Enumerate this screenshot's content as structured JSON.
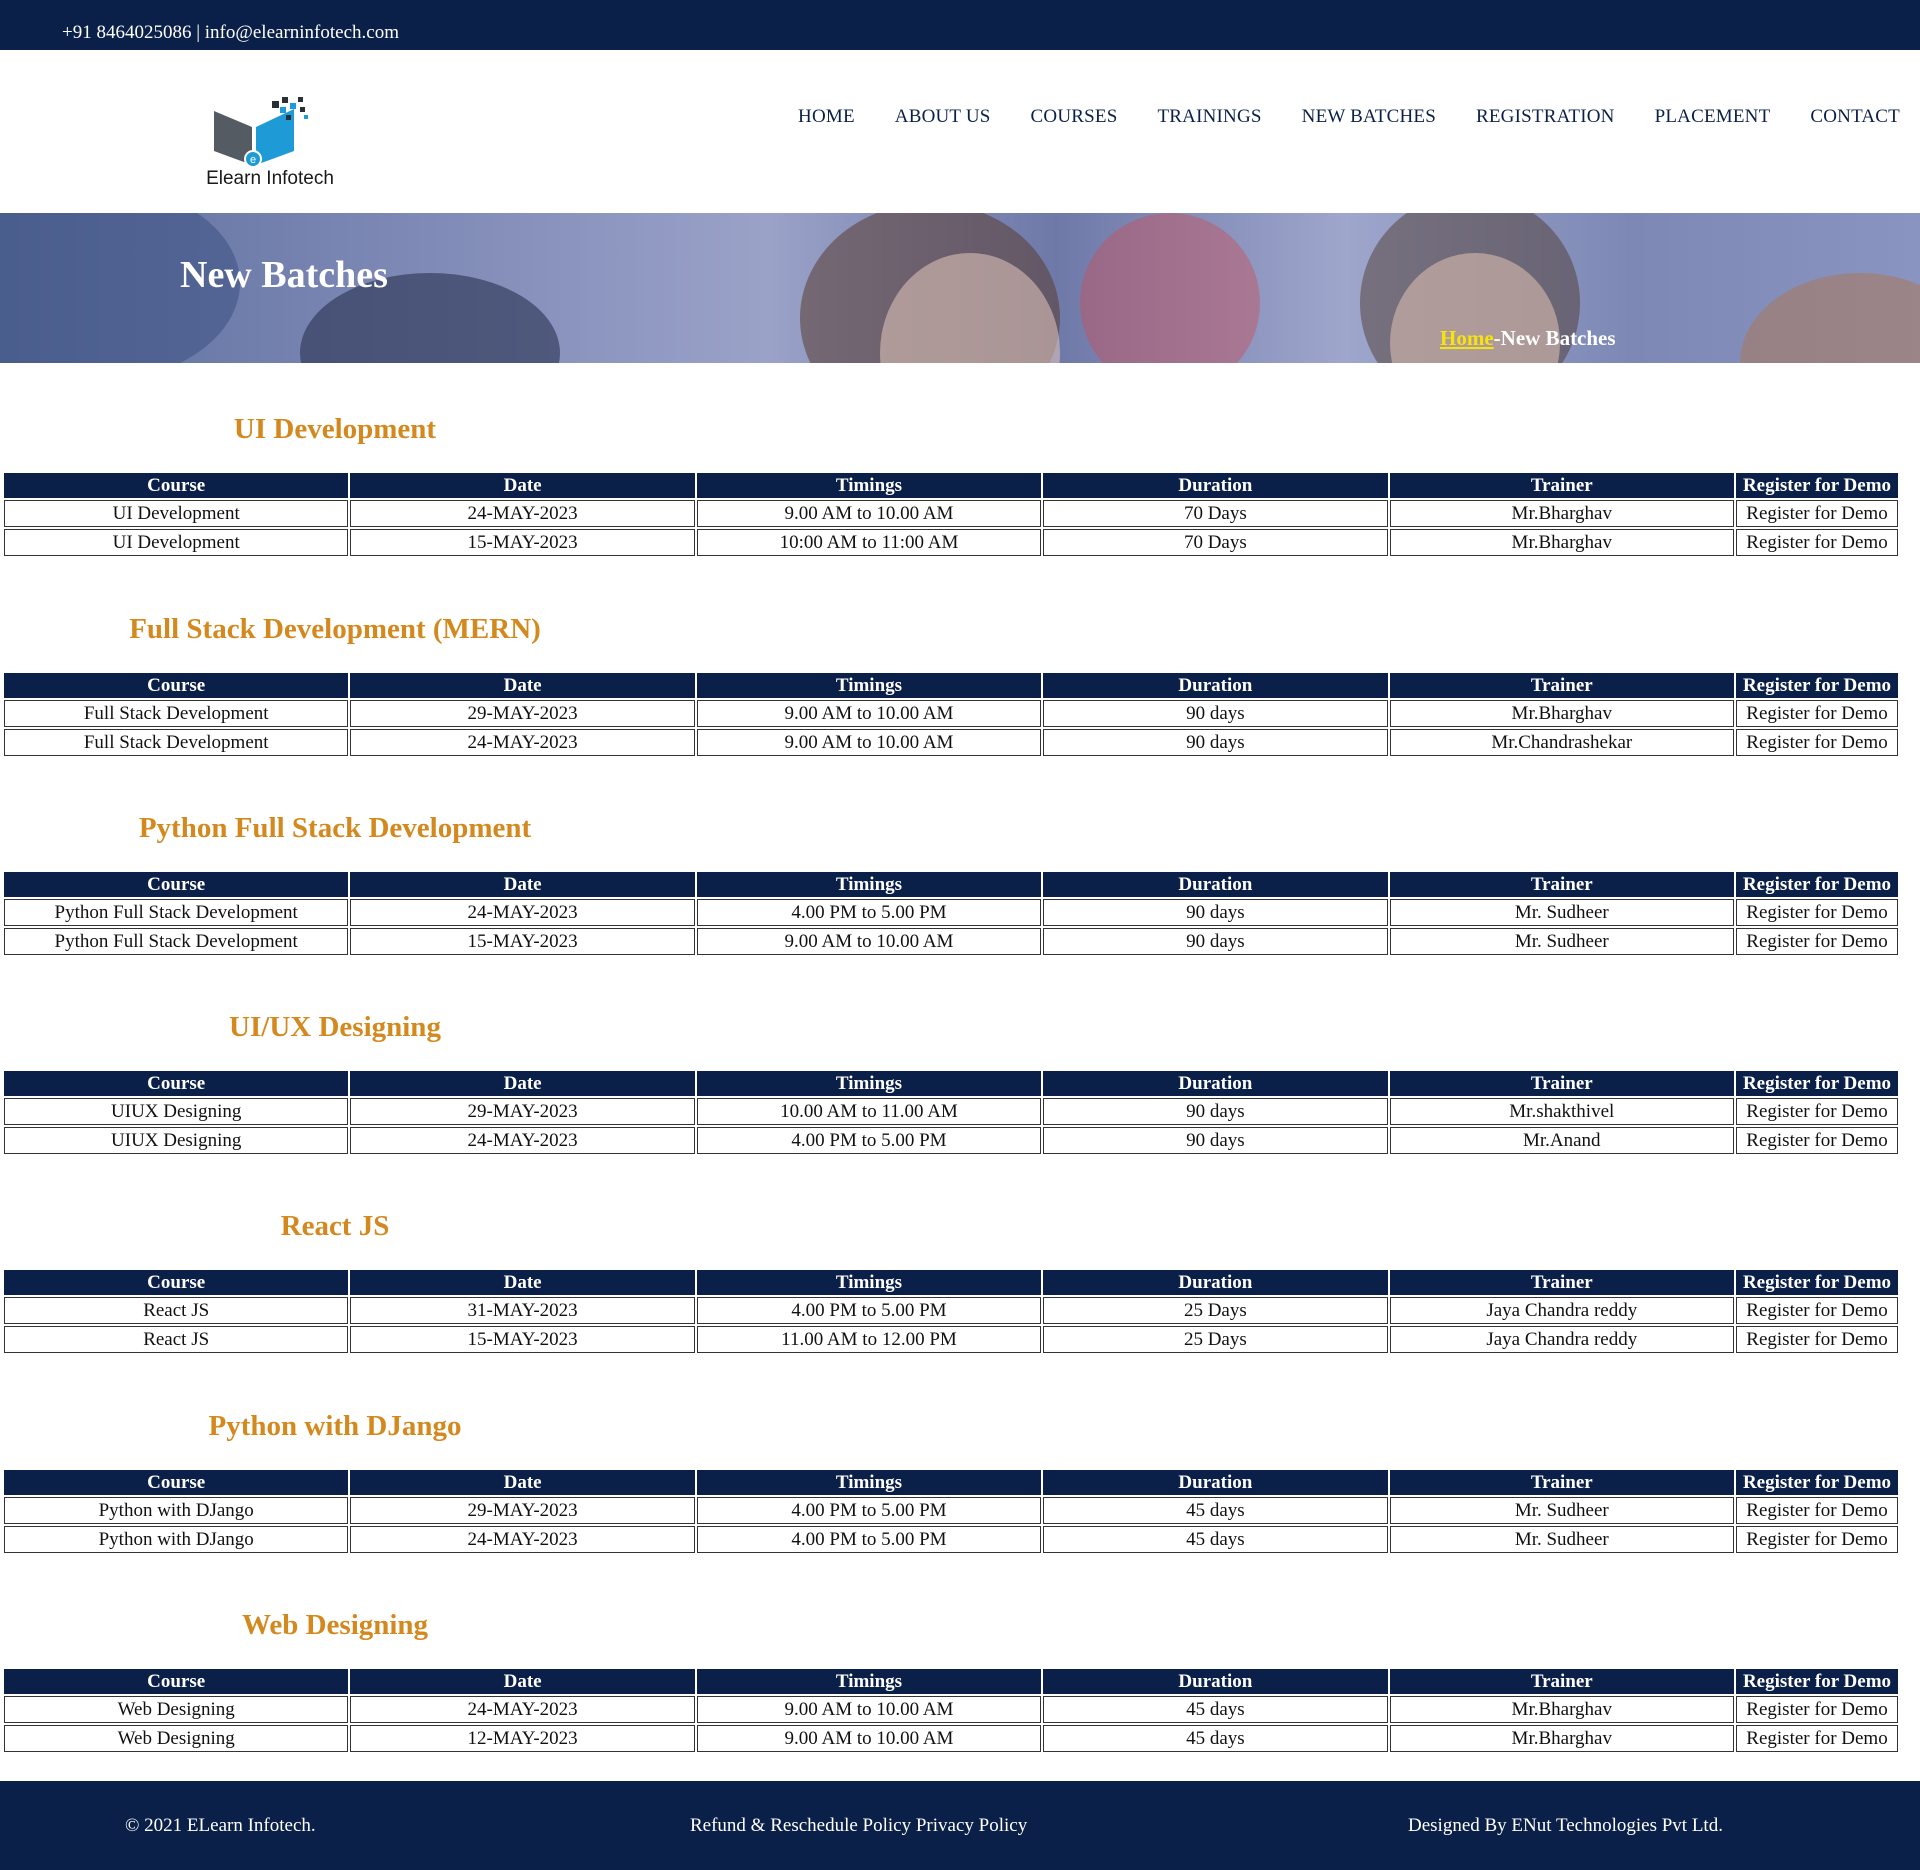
{
  "topbar": {
    "contact": "+91 8464025086 | info@elearninfotech.com"
  },
  "header": {
    "logo_text": "Elearn Infotech",
    "nav": [
      "HOME",
      "ABOUT US",
      "COURSES",
      "TRAININGS",
      "NEW BATCHES",
      "REGISTRATION",
      "PLACEMENT",
      "CONTACT"
    ]
  },
  "banner": {
    "title": "New Batches",
    "breadcrumb_home": "Home",
    "breadcrumb_sep": "-",
    "breadcrumb_current": "New Batches"
  },
  "table_headers": [
    "Course",
    "Date",
    "Timings",
    "Duration",
    "Trainer",
    "Register for Demo"
  ],
  "sections": [
    {
      "title": "UI Development",
      "rows": [
        [
          "UI Development",
          "24-MAY-2023",
          "9.00 AM to 10.00 AM",
          "70 Days",
          "Mr.Bharghav",
          "Register for Demo"
        ],
        [
          "UI Development",
          "15-MAY-2023",
          "10:00 AM to 11:00 AM",
          "70 Days",
          "Mr.Bharghav",
          "Register for Demo"
        ]
      ]
    },
    {
      "title": "Full Stack Development (MERN)",
      "rows": [
        [
          "Full Stack Development",
          "29-MAY-2023",
          "9.00 AM to 10.00 AM",
          "90 days",
          "Mr.Bharghav",
          "Register for Demo"
        ],
        [
          "Full Stack Development",
          "24-MAY-2023",
          "9.00 AM to 10.00 AM",
          "90 days",
          "Mr.Chandrashekar",
          "Register for Demo"
        ]
      ]
    },
    {
      "title": "Python Full Stack Development",
      "rows": [
        [
          "Python Full Stack Development",
          "24-MAY-2023",
          "4.00 PM to 5.00 PM",
          "90 days",
          "Mr. Sudheer",
          "Register for Demo"
        ],
        [
          "Python Full Stack Development",
          "15-MAY-2023",
          "9.00 AM to 10.00 AM",
          "90 days",
          "Mr. Sudheer",
          "Register for Demo"
        ]
      ]
    },
    {
      "title": "UI/UX Designing",
      "rows": [
        [
          "UIUX Designing",
          "29-MAY-2023",
          "10.00 AM to 11.00 AM",
          "90 days",
          "Mr.shakthivel",
          "Register for Demo"
        ],
        [
          "UIUX Designing",
          "24-MAY-2023",
          "4.00 PM to 5.00 PM",
          "90 days",
          "Mr.Anand",
          "Register for Demo"
        ]
      ]
    },
    {
      "title": "React JS",
      "rows": [
        [
          "React JS",
          "31-MAY-2023",
          "4.00 PM to 5.00 PM",
          "25 Days",
          "Jaya Chandra reddy",
          "Register for Demo"
        ],
        [
          "React JS",
          "15-MAY-2023",
          "11.00 AM to 12.00 PM",
          "25 Days",
          "Jaya Chandra reddy",
          "Register for Demo"
        ]
      ]
    },
    {
      "title": "Python with DJango",
      "rows": [
        [
          "Python with DJango",
          "29-MAY-2023",
          "4.00 PM to 5.00 PM",
          "45 days",
          "Mr. Sudheer",
          "Register for Demo"
        ],
        [
          "Python with DJango",
          "24-MAY-2023",
          "4.00 PM to 5.00 PM",
          "45 days",
          "Mr. Sudheer",
          "Register for Demo"
        ]
      ]
    },
    {
      "title": "Web Designing",
      "rows": [
        [
          "Web Designing",
          "24-MAY-2023",
          "9.00 AM to 10.00 AM",
          "45 days",
          "Mr.Bharghav",
          "Register for Demo"
        ],
        [
          "Web Designing",
          "12-MAY-2023",
          "9.00 AM to 10.00 AM",
          "45 days",
          "Mr.Bharghav",
          "Register for Demo"
        ]
      ]
    }
  ],
  "footer": {
    "copyright": "© 2021 ELearn Infotech.",
    "refund_link": "Refund & Reschedule Policy",
    "privacy_link": "Privacy Policy",
    "designed_by": "Designed By ENut Technologies Pvt Ltd."
  },
  "colors": {
    "navy": "#0b2048",
    "accent_orange": "#d4891f",
    "breadcrumb_yellow": "#f5e50c"
  }
}
